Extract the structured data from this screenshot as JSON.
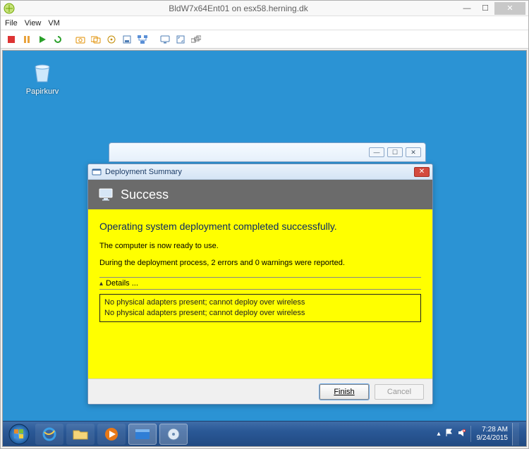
{
  "host": {
    "title": "BldW7x64Ent01 on esx58.herning.dk",
    "menus": {
      "file": "File",
      "view": "View",
      "vm": "VM"
    }
  },
  "desktop": {
    "recycle_label": "Papirkurv"
  },
  "dialog": {
    "title": "Deployment Summary",
    "header": "Success",
    "line1": "Operating system deployment completed successfully.",
    "line2": "The computer is now ready to use.",
    "line3": "During the deployment process, 2 errors and 0 warnings were reported.",
    "details_label": "Details ...",
    "errors": [
      "No physical adapters present; cannot deploy over wireless",
      "No physical adapters present; cannot deploy over wireless"
    ],
    "finish": "Finish",
    "cancel": "Cancel"
  },
  "tray": {
    "time": "7:28 AM",
    "date": "9/24/2015"
  }
}
